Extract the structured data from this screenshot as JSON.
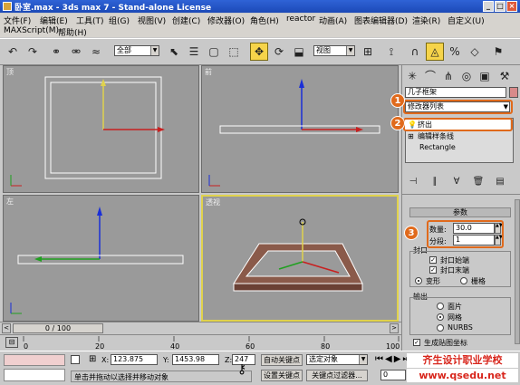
{
  "window": {
    "title": "卧室.max - 3ds max 7  - Stand-alone License",
    "buttons": [
      "_",
      "□",
      "×"
    ]
  },
  "menu": {
    "row1": [
      "文件(F)",
      "编辑(E)",
      "工具(T)",
      "组(G)",
      "视图(V)",
      "创建(C)",
      "修改器(O)",
      "角色(H)",
      "reactor",
      "动画(A)",
      "图表编辑器(D)",
      "渲染(R)",
      "自定义(U)"
    ],
    "row2": [
      "MAXScript(M)",
      "帮助(H)"
    ]
  },
  "toolbar": {
    "selection_filter": "全部",
    "ref_coord": "视图"
  },
  "viewports": {
    "top": "顶",
    "front": "前",
    "left": "左",
    "perspective": "透视"
  },
  "command_panel": {
    "object_name": "几子框架",
    "modifier_list": "修改器列表",
    "stack": [
      "挤出",
      "编辑样条线",
      "Rectangle"
    ],
    "parameters": {
      "rollout_title": "参数",
      "amount_label": "数量:",
      "amount_value": "30.0",
      "segments_label": "分段:",
      "segments_value": "1",
      "capping_group": "封口",
      "cap_start": "封口始端",
      "cap_end": "封口末端",
      "morph": "变形",
      "grid": "栅格",
      "output_group": "输出",
      "patch": "面片",
      "mesh": "网格",
      "nurbs": "NURBS",
      "gen_mapping": "生成贴图坐标"
    },
    "badges": [
      "1",
      "2",
      "3"
    ]
  },
  "timeline": {
    "frame": "0 / 100"
  },
  "trackbar": {
    "ticks": [
      "0",
      "20",
      "40",
      "60",
      "80",
      "100"
    ]
  },
  "status": {
    "x_label": "X:",
    "x_value": "123.875",
    "y_label": "Y:",
    "y_value": "1453.98",
    "z_label": "Z:",
    "z_value": "247",
    "auto_key": "自动关键点",
    "set_key": "设置关键点",
    "selected_object": "选定对象",
    "key_filters": "关键点过滤器...",
    "prompt": "单击并拖动以选择并移动对象",
    "frame_value": "0"
  },
  "watermark": {
    "line1": "齐生设计职业学校",
    "line2": "www.qsedu.net"
  },
  "colors": {
    "accent": "#e06a1c",
    "viewport_bg": "#9a9a9a",
    "active_border": "#e0d24c"
  }
}
